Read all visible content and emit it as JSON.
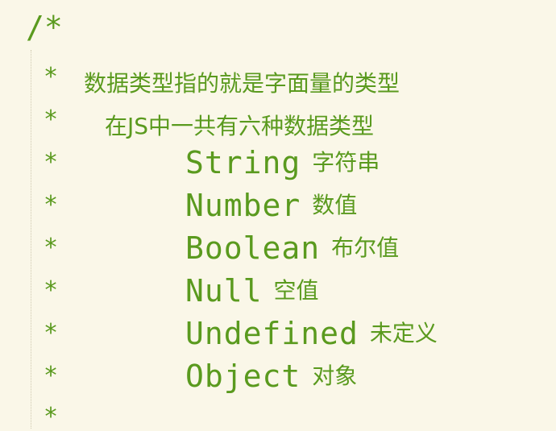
{
  "comment": {
    "open": "/*",
    "star": "*",
    "line1": "数据类型指的就是字面量的类型",
    "line2": "在JS中一共有六种数据类型",
    "types": [
      {
        "name": "String",
        "desc": "字符串"
      },
      {
        "name": "Number",
        "desc": "数值"
      },
      {
        "name": "Boolean",
        "desc": "布尔值"
      },
      {
        "name": "Null",
        "desc": "空值"
      },
      {
        "name": "Undefined",
        "desc": "未定义"
      },
      {
        "name": "Object",
        "desc": "对象"
      }
    ]
  },
  "colors": {
    "background": "#faf7e8",
    "comment_green": "#5a9a1e"
  }
}
